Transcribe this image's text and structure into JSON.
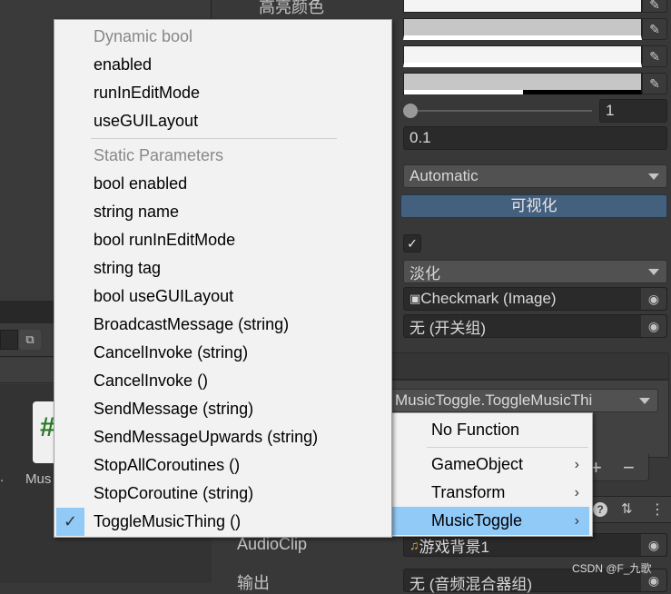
{
  "inspector": {
    "highlight_color_label": "高亮颜色",
    "slider_value": "1",
    "slider_fraction": 0,
    "fade_duration": "0.1",
    "navigation": "Automatic",
    "visualize_button": "可视化",
    "is_on": true,
    "transition": "淡化",
    "graphic": "Checkmark (Image)",
    "group": "无 (开关组)",
    "event_function": "MusicToggle.ToggleMusicThi",
    "add_label": "+",
    "remove_label": "−",
    "audio_clip_label": "AudioClip",
    "audio_clip_value": "游戏背景1",
    "output_label": "输出",
    "output_value": "无 (音频混合器组)",
    "accent_color": "#44607f"
  },
  "left_panel": {
    "asset_label": "Mus",
    "dot": "."
  },
  "method_menu": {
    "sections": [
      {
        "header": "Dynamic bool",
        "items": [
          "enabled",
          "runInEditMode",
          "useGUILayout"
        ]
      },
      {
        "header": "Static Parameters",
        "items": [
          "bool enabled",
          "string name",
          "bool runInEditMode",
          "string tag",
          "bool useGUILayout",
          "BroadcastMessage (string)",
          "CancelInvoke (string)",
          "CancelInvoke ()",
          "SendMessage (string)",
          "SendMessageUpwards (string)",
          "StopAllCoroutines ()",
          "StopCoroutine (string)",
          "ToggleMusicThing ()"
        ]
      }
    ],
    "selected": "ToggleMusicThing ()",
    "check_icon": "✓",
    "selection_color": "#91c9f7"
  },
  "component_menu": {
    "items": [
      "No Function",
      "GameObject",
      "Transform",
      "MusicToggle"
    ],
    "highlighted": "MusicToggle"
  },
  "watermark": "CSDN @F_九歌"
}
